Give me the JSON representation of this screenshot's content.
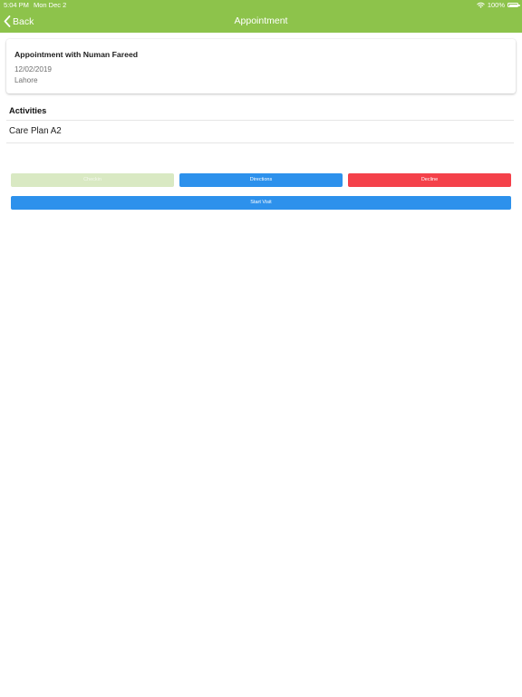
{
  "status_bar": {
    "time": "5:04 PM",
    "date": "Mon Dec 2",
    "battery_text": "100%",
    "battery_level": 1.0
  },
  "nav": {
    "back_label": "Back",
    "title": "Appointment",
    "bg_color": "#8dc34b"
  },
  "appointment": {
    "title": "Appointment with Numan Fareed",
    "date": "12/02/2019",
    "location": "Lahore"
  },
  "activities": {
    "heading": "Activities",
    "items": [
      "Care Plan A2"
    ]
  },
  "actions": {
    "checkin_label": "Checkin",
    "directions_label": "Directions",
    "decline_label": "Decline",
    "start_visit_label": "Start Visit",
    "colors": {
      "checkin_disabled": "#d9e9c3",
      "directions": "#2d91ec",
      "decline": "#f4414a",
      "start_visit": "#2d91ec"
    }
  },
  "icons": [
    "wifi-icon",
    "battery-icon",
    "chevron-left-icon"
  ]
}
